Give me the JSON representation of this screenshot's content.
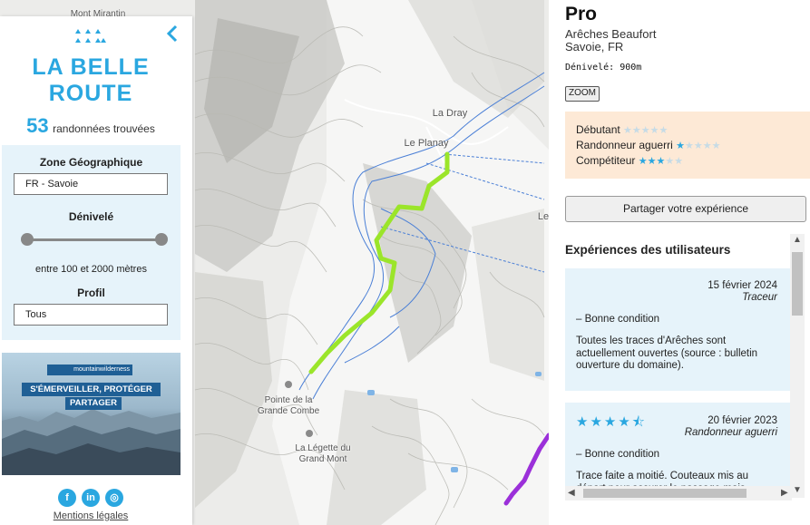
{
  "map": {
    "labels": {
      "mont_mirantin": "Mont Mirantin",
      "la_dray": "La Dray",
      "le_planay": "Le Planay",
      "le_cut": "Le",
      "pointe": "Pointe de la\nGrande Combe",
      "legette": "La Légette du\nGrand Mont"
    },
    "route_color": "#9be52a",
    "other_route_color": "#9b30d9",
    "ski_lift_color": "#4a7fd6"
  },
  "sidebar": {
    "logo_line1": "LA BELLE",
    "logo_line2": "ROUTE",
    "collapse_icon": "chevron-left-icon",
    "result_count": "53",
    "result_text": "randonnées trouvées",
    "filters": {
      "zone_label": "Zone Géographique",
      "zone_value": "FR - Savoie",
      "denivele_label": "Dénivelé",
      "denivele_min_fraction": 0,
      "denivele_max_fraction": 1,
      "range_text": "entre 100 et 2000 mètres",
      "profil_label": "Profil",
      "profil_value": "Tous"
    },
    "ad": {
      "brand": "mountainwilderness",
      "line1": "S'ÉMERVEILLER, PROTÉGER",
      "line2": "PARTAGER"
    },
    "social": {
      "facebook": "f",
      "linkedin": "in",
      "instagram": "◎"
    },
    "legal": "Mentions légales",
    "accent_color": "#2aa7e0"
  },
  "panel": {
    "title": "Pro",
    "location_line1": "Arêches Beaufort",
    "location_line2": "Savoie, FR",
    "denivele": "Dénivelé: 900m",
    "zoom_label": "ZOOM",
    "levels": [
      {
        "label": "Débutant",
        "rating": 0
      },
      {
        "label": "Randonneur aguerri",
        "rating": 1
      },
      {
        "label": "Compétiteur",
        "rating": 3
      }
    ],
    "share_label": "Partager votre expérience",
    "experiences_title": "Expériences des utilisateurs",
    "experiences": [
      {
        "date": "15 février 2024",
        "role": "Traceur",
        "rating": 0,
        "condition": "– Bonne condition",
        "text": "Toutes les traces d'Arêches sont actuellement ouvertes (source : bulletin ouverture du domaine)."
      },
      {
        "date": "20 février 2023",
        "role": "Randonneur aguerri",
        "rating": 4.5,
        "stars_display": "★★★★⯪",
        "condition": "– Bonne condition",
        "text": "Trace faite a moitié. Couteaux mis au départ pour assurer le passage mais"
      }
    ]
  }
}
